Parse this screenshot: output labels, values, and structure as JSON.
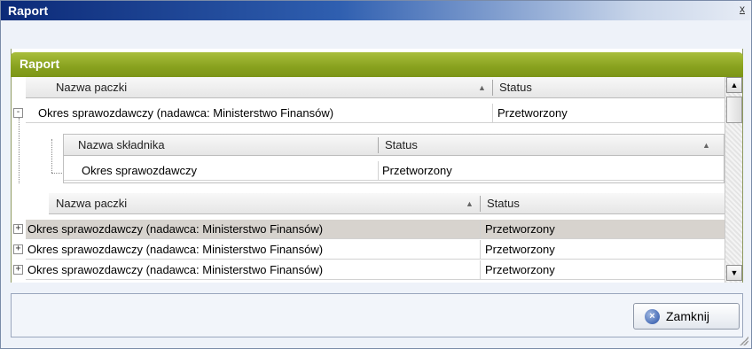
{
  "window": {
    "title": "Raport",
    "close_glyph": "x"
  },
  "panel": {
    "title": "Raport"
  },
  "grid": {
    "top_header": {
      "col_name": "Nazwa paczki",
      "col_status": "Status",
      "sort_glyph": "▲"
    },
    "expanded_row": {
      "name": "Okres sprawozdawczy (nadawca: Ministerstwo Finansów)",
      "status": "Przetworzony",
      "toggle": "-"
    },
    "nested": {
      "header": {
        "col_name": "Nazwa składnika",
        "col_status": "Status",
        "sort_glyph": "▲"
      },
      "rows": [
        {
          "name": "Okres sprawozdawczy",
          "status": "Przetworzony"
        }
      ]
    },
    "second_header": {
      "col_name": "Nazwa paczki",
      "col_status": "Status",
      "sort_glyph": "▲"
    },
    "rows": [
      {
        "name": "Okres sprawozdawczy (nadawca: Ministerstwo Finansów)",
        "status": "Przetworzony",
        "toggle": "+"
      },
      {
        "name": "Okres sprawozdawczy (nadawca: Ministerstwo Finansów)",
        "status": "Przetworzony",
        "toggle": "+"
      },
      {
        "name": "Okres sprawozdawczy (nadawca: Ministerstwo Finansów)",
        "status": "Przetworzony",
        "toggle": "+"
      }
    ],
    "scroll": {
      "up": "▲",
      "down": "▼"
    }
  },
  "footer": {
    "close_button_label": "Zamknij",
    "close_icon": "×"
  },
  "colors": {
    "title_bar": "#0c2a78",
    "panel_header": "#88a11e",
    "selected_row": "#d7d3ce"
  }
}
